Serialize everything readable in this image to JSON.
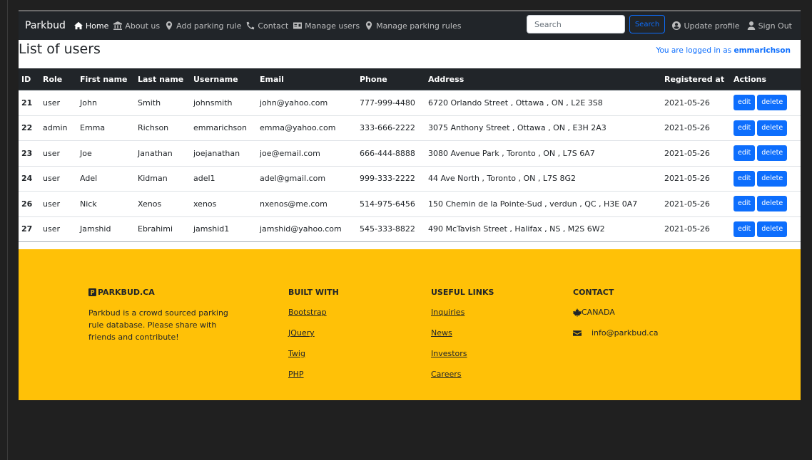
{
  "nav": {
    "brand": "Parkbud",
    "links": [
      {
        "label": "Home",
        "icon": "home-icon"
      },
      {
        "label": "About us",
        "icon": "landmark-icon"
      },
      {
        "label": "Add parking rule",
        "icon": "map-marker-icon"
      },
      {
        "label": "Contact",
        "icon": "phone-icon"
      },
      {
        "label": "Manage users",
        "icon": "id-card-icon"
      },
      {
        "label": "Manage parking rules",
        "icon": "map-marker-icon"
      }
    ],
    "search_placeholder": "Search",
    "search_button": "Search",
    "update_profile": "Update profile",
    "sign_out": "Sign Out"
  },
  "header": {
    "title": "List of users",
    "logged_prefix": "You are logged in as",
    "username": "emmarichson"
  },
  "table": {
    "columns": [
      "ID",
      "Role",
      "First name",
      "Last name",
      "Username",
      "Email",
      "Phone",
      "Address",
      "Registered at",
      "Actions"
    ],
    "rows": [
      {
        "id": "21",
        "role": "user",
        "first": "John",
        "last": "Smith",
        "username": "johnsmith",
        "email": "john@yahoo.com",
        "phone": "777-999-4480",
        "address": "6720 Orlando Street , Ottawa , ON , L2E 3S8",
        "registered": "2021-05-26"
      },
      {
        "id": "22",
        "role": "admin",
        "first": "Emma",
        "last": "Richson",
        "username": "emmarichson",
        "email": "emma@yahoo.com",
        "phone": "333-666-2222",
        "address": "3075 Anthony Street , Ottawa , ON , E3H 2A3",
        "registered": "2021-05-26"
      },
      {
        "id": "23",
        "role": "user",
        "first": "Joe",
        "last": "Janathan",
        "username": "joejanathan",
        "email": "joe@email.com",
        "phone": "666-444-8888",
        "address": "3080 Avenue Park , Toronto , ON , L7S 6A7",
        "registered": "2021-05-26"
      },
      {
        "id": "24",
        "role": "user",
        "first": "Adel",
        "last": "Kidman",
        "username": "adel1",
        "email": "adel@gmail.com",
        "phone": "999-333-2222",
        "address": "44 Ave North , Toronto , ON , L7S 8G2",
        "registered": "2021-05-26"
      },
      {
        "id": "26",
        "role": "user",
        "first": "Nick",
        "last": "Xenos",
        "username": "xenos",
        "email": "nxenos@me.com",
        "phone": "514-975-6456",
        "address": "150 Chemin de la Pointe-Sud , verdun , QC , H3E 0A7",
        "registered": "2021-05-26"
      },
      {
        "id": "27",
        "role": "user",
        "first": "Jamshid",
        "last": "Ebrahimi",
        "username": "jamshid1",
        "email": "jamshid@yahoo.com",
        "phone": "545-333-8822",
        "address": "490 McTavish Street , Halifax , NS , M2S 6W2",
        "registered": "2021-05-26"
      }
    ],
    "edit_label": "edit",
    "delete_label": "delete"
  },
  "footer": {
    "brand_title": "PARKBUD.CA",
    "brand_desc": "Parkbud is a crowd sourced parking rule database. Please share with friends and contribute!",
    "built_title": "BUILT WITH",
    "built_links": [
      "Bootstrap",
      "JQuery",
      "Twig",
      "PHP"
    ],
    "useful_title": "USEFUL LINKS",
    "useful_links": [
      "Inquiries",
      "News",
      "Investors",
      "Careers"
    ],
    "contact_title": "CONTACT",
    "country": "CANADA",
    "email": "info@parkbud.ca"
  },
  "colors": {
    "navbar": "#212529",
    "primary": "#0d6efd",
    "footer": "#ffc107",
    "page_background": "#202020"
  }
}
